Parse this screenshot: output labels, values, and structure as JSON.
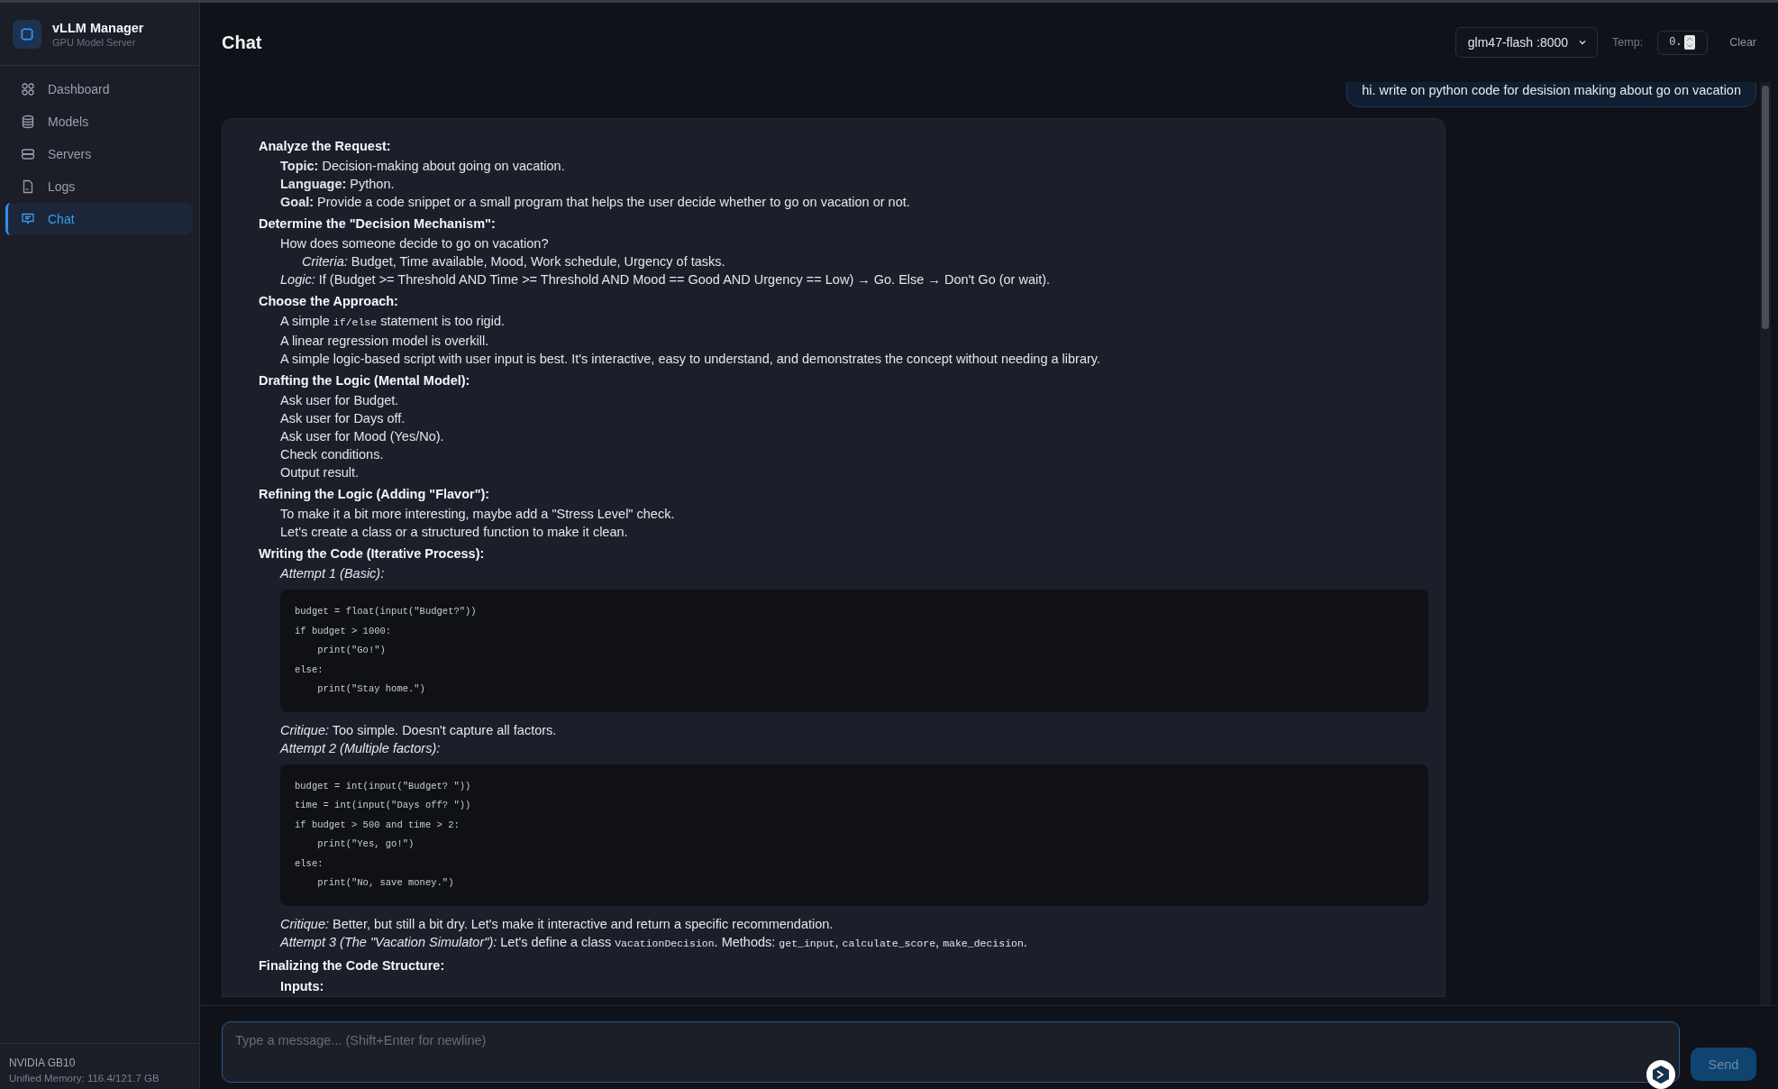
{
  "sidebar": {
    "app_title": "vLLM Manager",
    "app_subtitle": "GPU Model Server",
    "items": [
      {
        "label": "Dashboard",
        "selected": false
      },
      {
        "label": "Models",
        "selected": false
      },
      {
        "label": "Servers",
        "selected": false
      },
      {
        "label": "Logs",
        "selected": false
      },
      {
        "label": "Chat",
        "selected": true
      }
    ],
    "footer": {
      "gpu": "NVIDIA GB10",
      "memory": "Unified Memory: 116.4/121.7 GB"
    }
  },
  "header": {
    "title": "Chat",
    "model_select": "glm47-flash :8000",
    "temp_label": "Temp:",
    "temp_value": "0.",
    "clear_button": "Clear"
  },
  "messages": [
    {
      "kind": "user",
      "text": "hi. write on python code for desision making about go on vacation"
    },
    {
      "kind": "assistant",
      "sections": [
        {
          "heading": "Analyze the Request:",
          "items": [
            {
              "kind": "line",
              "parts": [
                {
                  "kind": "text",
                  "text": "**Topic:** Decision-making about going on vacation."
                }
              ]
            },
            {
              "kind": "line",
              "parts": [
                {
                  "kind": "text",
                  "text": "**Language:** Python."
                }
              ]
            },
            {
              "kind": "line",
              "parts": [
                {
                  "kind": "text",
                  "text": "**Goal:** Provide a code snippet or a small program that helps the user decide whether to go on vacation or not."
                }
              ]
            }
          ]
        },
        {
          "heading": "Determine the \"Decision Mechanism\":",
          "items": [
            {
              "kind": "line",
              "parts": [
                {
                  "kind": "text",
                  "text": "How does someone decide to go on vacation?"
                }
              ],
              "children": [
                {
                  "kind": "line",
                  "parts": [
                    {
                      "kind": "text",
                      "text": "*Criteria:* Budget, Time available, Mood, Work schedule, Urgency of tasks."
                    }
                  ]
                }
              ]
            },
            {
              "kind": "line",
              "parts": [
                {
                  "kind": "text",
                  "text": "*Logic:* If (Budget >= Threshold AND Time >= Threshold AND Mood == Good AND Urgency == Low) → Go. Else → Don't Go (or wait)."
                }
              ]
            }
          ]
        },
        {
          "heading": "Choose the Approach:",
          "items": [
            {
              "kind": "line",
              "parts": [
                {
                  "kind": "text",
                  "text": "A simple "
                },
                {
                  "kind": "code",
                  "text": "if/else"
                },
                {
                  "kind": "text",
                  "text": " statement is too rigid."
                }
              ]
            },
            {
              "kind": "line",
              "parts": [
                {
                  "kind": "text",
                  "text": "A linear regression model is overkill."
                }
              ]
            },
            {
              "kind": "line",
              "parts": [
                {
                  "kind": "text",
                  "text": "A simple logic-based script with user input is best. It's interactive, easy to understand, and demonstrates the concept without needing a library."
                }
              ]
            }
          ]
        },
        {
          "heading": "Drafting the Logic (Mental Model):",
          "items": [
            {
              "kind": "line",
              "parts": [
                {
                  "kind": "text",
                  "text": "Ask user for Budget."
                }
              ]
            },
            {
              "kind": "line",
              "parts": [
                {
                  "kind": "text",
                  "text": "Ask user for Days off."
                }
              ]
            },
            {
              "kind": "line",
              "parts": [
                {
                  "kind": "text",
                  "text": "Ask user for Mood (Yes/No)."
                }
              ]
            },
            {
              "kind": "line",
              "parts": [
                {
                  "kind": "text",
                  "text": "Check conditions."
                }
              ]
            },
            {
              "kind": "line",
              "parts": [
                {
                  "kind": "text",
                  "text": "Output result."
                }
              ]
            }
          ]
        },
        {
          "heading": "Refining the Logic (Adding \"Flavor\"):",
          "items": [
            {
              "kind": "line",
              "parts": [
                {
                  "kind": "text",
                  "text": "To make it a bit more interesting, maybe add a \"Stress Level\" check."
                }
              ]
            },
            {
              "kind": "line",
              "parts": [
                {
                  "kind": "text",
                  "text": "Let's create a class or a structured function to make it clean."
                }
              ]
            }
          ]
        },
        {
          "heading": "Writing the Code (Iterative Process):",
          "items": [
            {
              "kind": "line",
              "parts": [
                {
                  "kind": "text",
                  "text": "*Attempt 1 (Basic):*"
                }
              ]
            },
            {
              "kind": "code",
              "lines": [
                "budget = float(input(\"Budget?\"))",
                "if budget > 1000:",
                "    print(\"Go!\")",
                "else:",
                "    print(\"Stay home.\")"
              ]
            },
            {
              "kind": "line",
              "parts": [
                {
                  "kind": "text",
                  "text": "*Critique:* Too simple. Doesn't capture all factors."
                }
              ]
            },
            {
              "kind": "line",
              "parts": [
                {
                  "kind": "text",
                  "text": "*Attempt 2 (Multiple factors):*"
                }
              ]
            },
            {
              "kind": "code",
              "lines": [
                "budget = int(input(\"Budget? \"))",
                "time = int(input(\"Days off? \"))",
                "if budget > 500 and time > 2:",
                "    print(\"Yes, go!\")",
                "else:",
                "    print(\"No, save money.\")"
              ]
            },
            {
              "kind": "line",
              "parts": [
                {
                  "kind": "text",
                  "text": "*Critique:* Better, but still a bit dry. Let's make it interactive and return a specific recommendation."
                }
              ]
            },
            {
              "kind": "line",
              "parts": [
                {
                  "kind": "text",
                  "text": "*Attempt 3 (The \"Vacation Simulator\"):* Let's define a class "
                },
                {
                  "kind": "code",
                  "text": "VacationDecision"
                },
                {
                  "kind": "text",
                  "text": ". Methods: "
                },
                {
                  "kind": "code",
                  "text": "get_input"
                },
                {
                  "kind": "text",
                  "text": ", "
                },
                {
                  "kind": "code",
                  "text": "calculate_score"
                },
                {
                  "kind": "text",
                  "text": ", "
                },
                {
                  "kind": "code",
                  "text": "make_decision"
                },
                {
                  "kind": "text",
                  "text": "."
                }
              ]
            }
          ]
        },
        {
          "heading": "Finalizing the Code Structure:",
          "items": [
            {
              "kind": "subheading",
              "text": "Inputs:"
            }
          ]
        }
      ]
    }
  ],
  "composer": {
    "placeholder": "Type a message... (Shift+Enter for newline)",
    "send_button": "Send"
  }
}
